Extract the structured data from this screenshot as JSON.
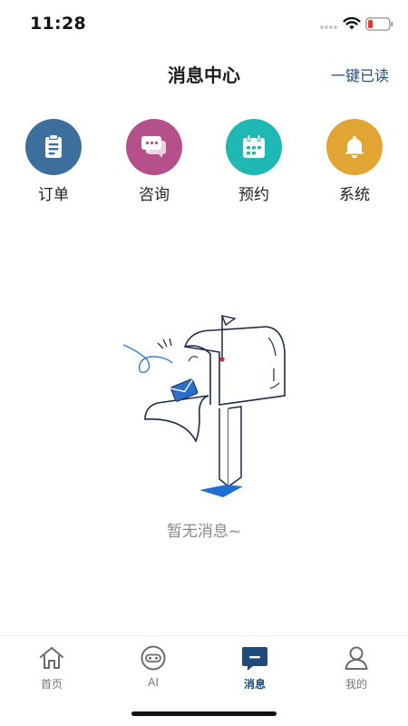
{
  "status_bar": {
    "time": "11:28",
    "battery_color": "#e53935"
  },
  "header": {
    "title": "消息中心",
    "mark_all_read": "一键已读"
  },
  "categories": [
    {
      "label": "订单",
      "icon": "clipboard-icon",
      "color": "#3d6f9c"
    },
    {
      "label": "咨询",
      "icon": "chat-bubbles-icon",
      "color": "#b5508a"
    },
    {
      "label": "预约",
      "icon": "calendar-icon",
      "color": "#1fb8b5"
    },
    {
      "label": "系统",
      "icon": "bell-icon",
      "color": "#e2a533"
    }
  ],
  "empty_state": {
    "illustration": "mailbox-illustration",
    "text": "暂无消息~"
  },
  "tab_bar": {
    "items": [
      {
        "label": "首页",
        "icon": "home-icon",
        "active": false
      },
      {
        "label": "AI",
        "icon": "robot-icon",
        "active": false
      },
      {
        "label": "消息",
        "icon": "message-icon",
        "active": true
      },
      {
        "label": "我的",
        "icon": "user-icon",
        "active": false
      }
    ],
    "active_color": "#1d4b7c"
  }
}
